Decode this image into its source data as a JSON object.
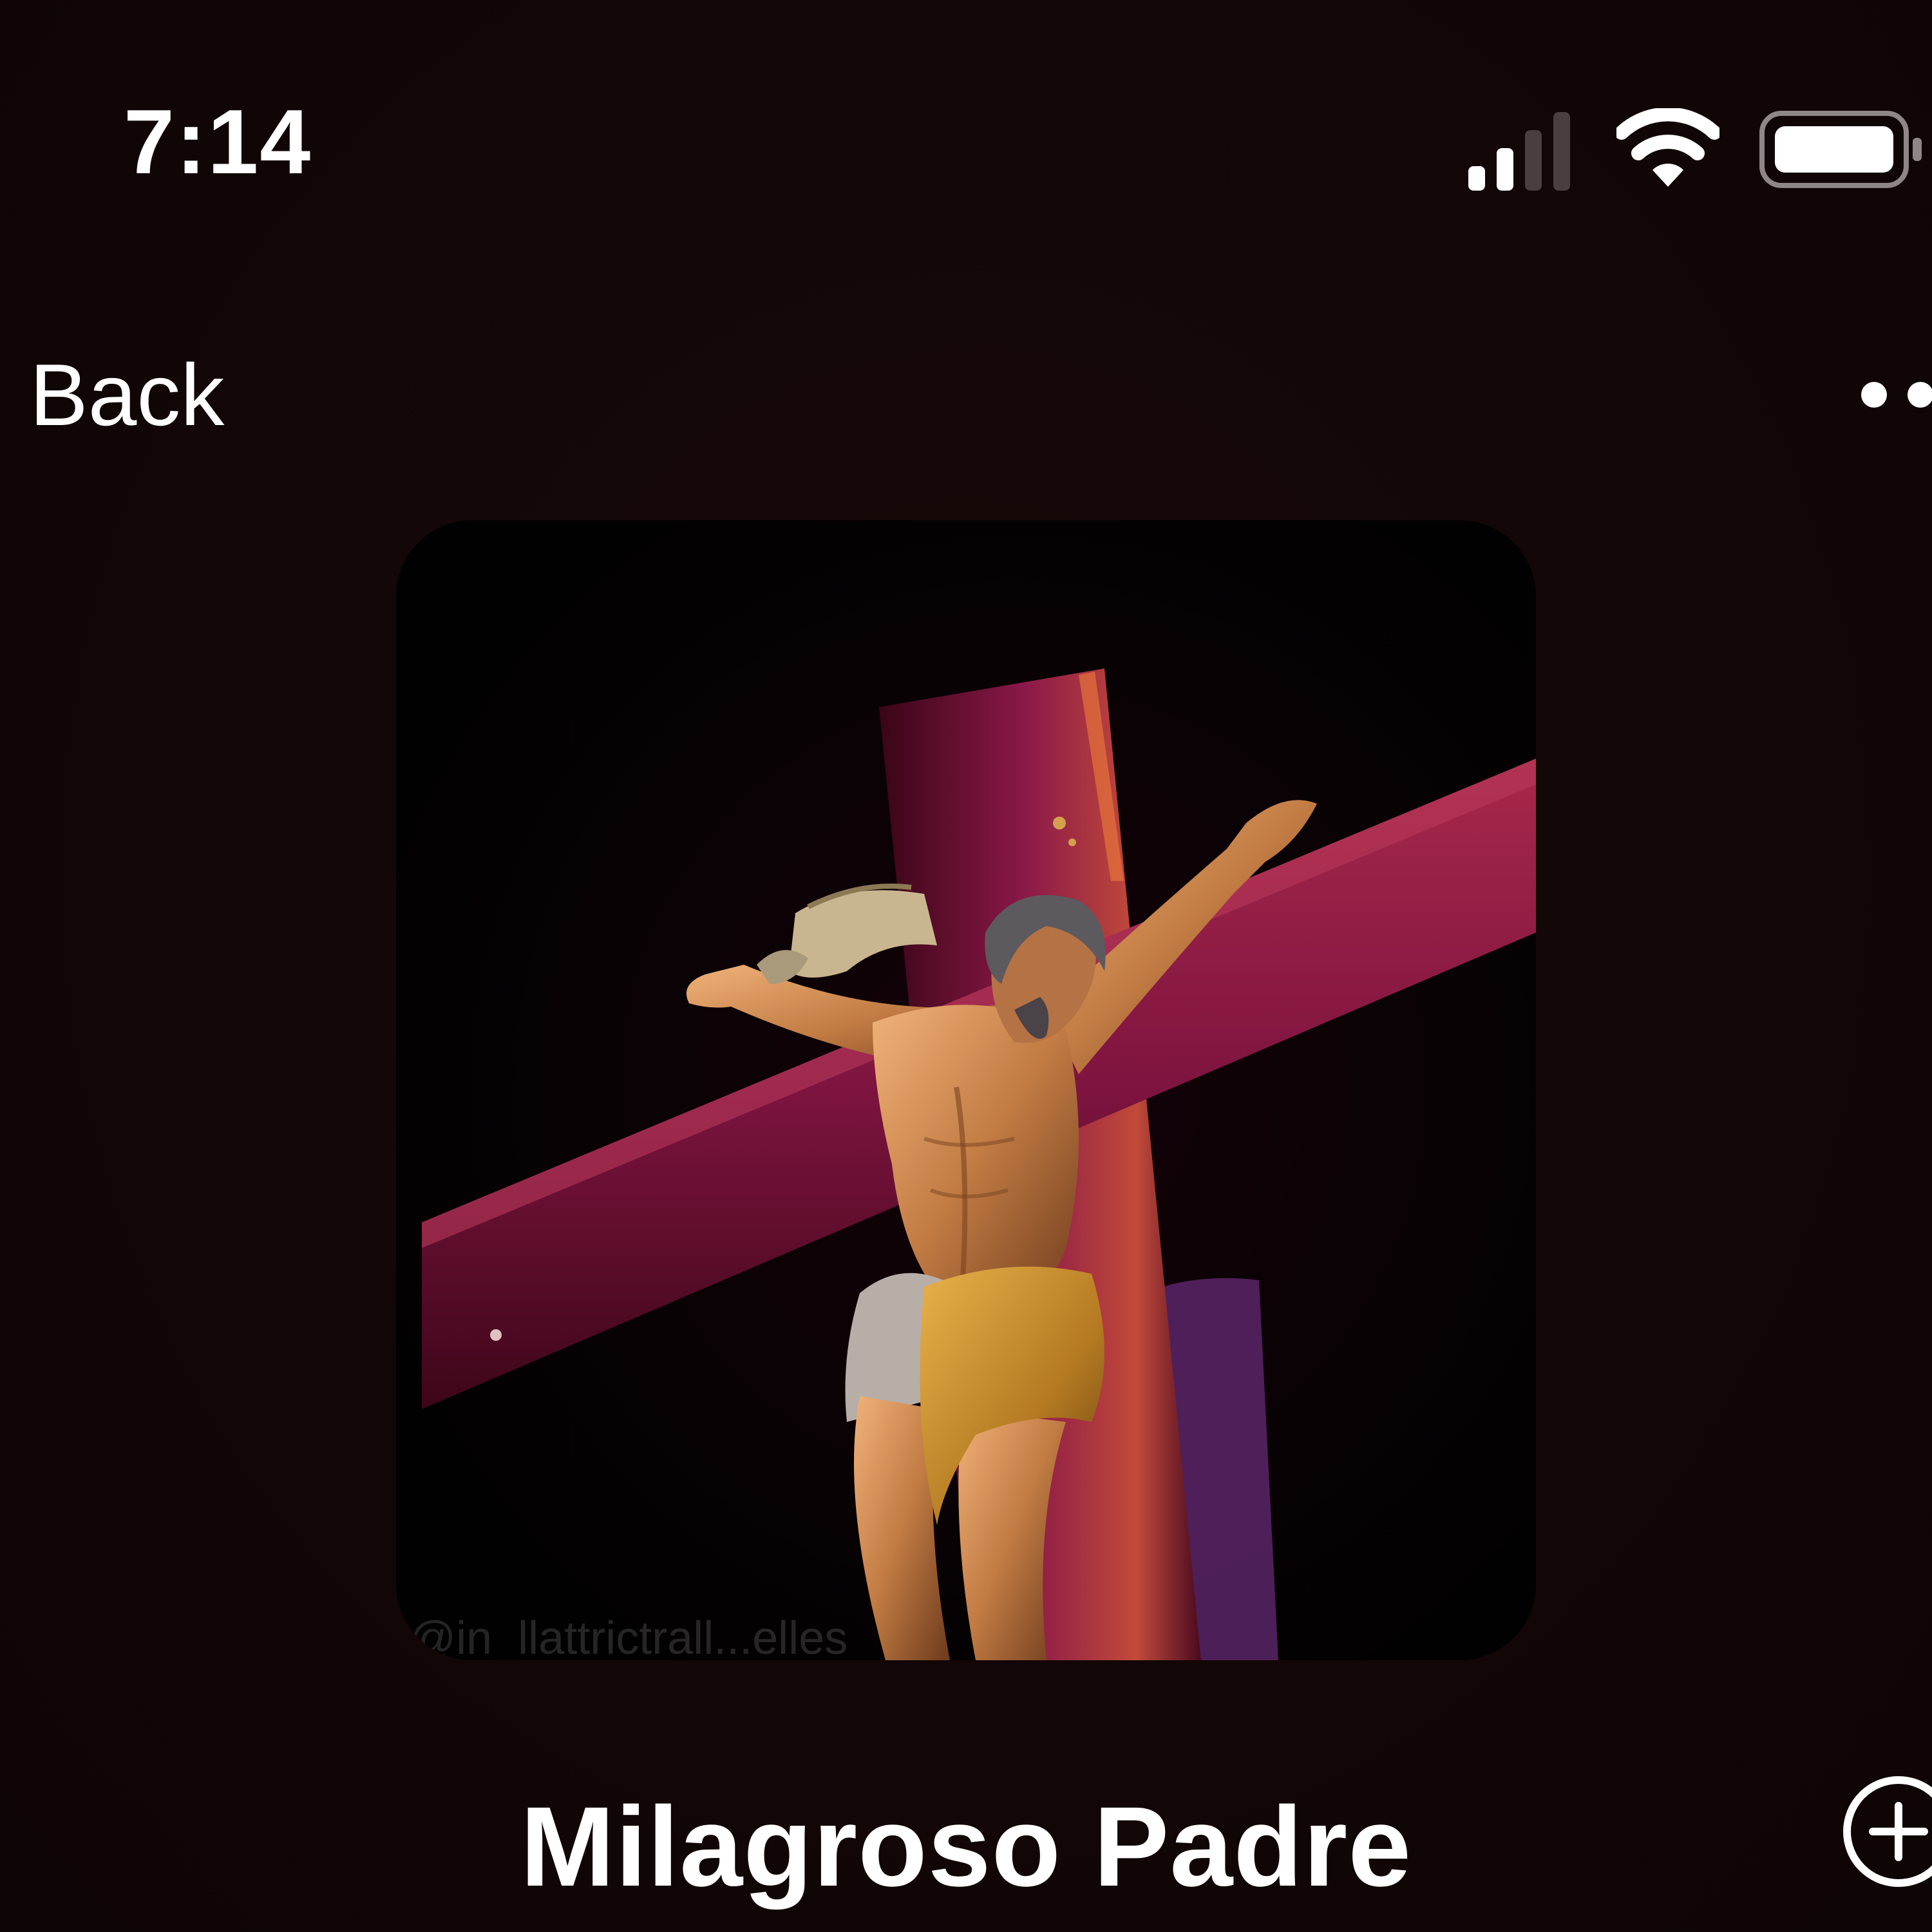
{
  "status_bar": {
    "time": "7:14",
    "icons": [
      "cellular-signal-icon",
      "wifi-icon",
      "battery-icon"
    ]
  },
  "nav": {
    "back_label": "Back",
    "more_icon": "ellipsis-icon"
  },
  "artwork": {
    "watermark": "@in_llattrictrall...elles"
  },
  "album": {
    "title": "Milagroso Padre",
    "add_icon": "plus-circle-icon"
  },
  "colors": {
    "background": "#120606",
    "text": "#ffffff",
    "cross": "#6e1035",
    "cloth": "#c48a2a"
  }
}
